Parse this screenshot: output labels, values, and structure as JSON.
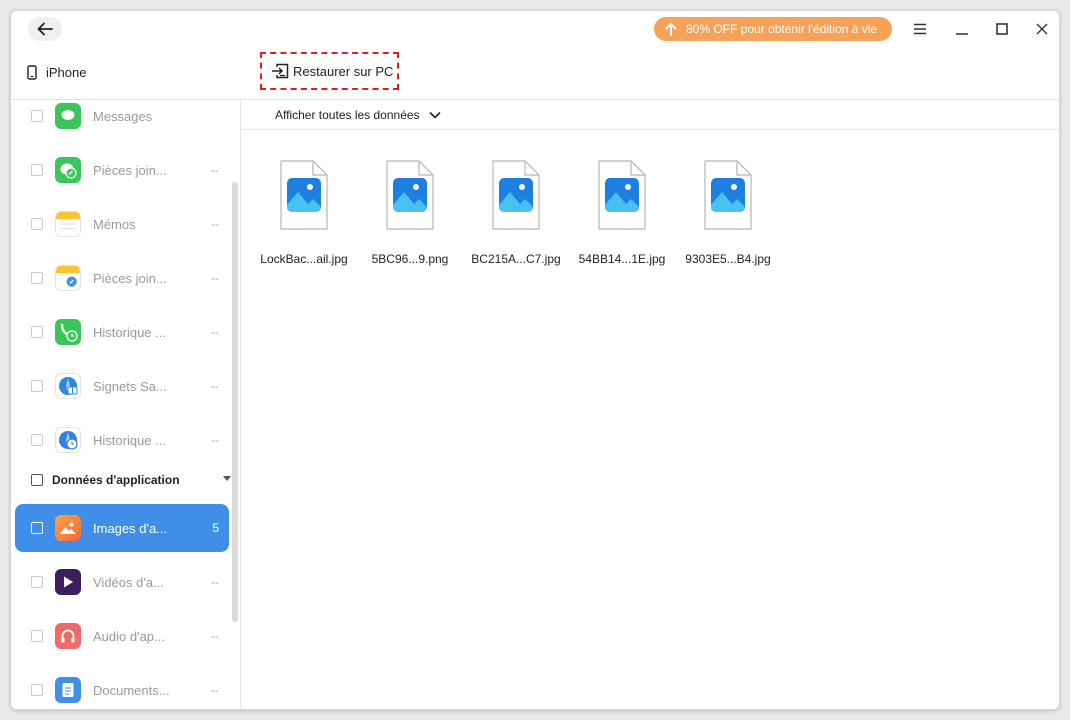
{
  "promo": {
    "label": "80% OFF pour obtenir l'édition à vie"
  },
  "device": {
    "name": "iPhone"
  },
  "toolbar": {
    "restore_label": "Restaurer sur PC"
  },
  "filter": {
    "label": "Afficher toutes les données"
  },
  "sidebar": {
    "items": [
      {
        "label": "Messages",
        "count": ""
      },
      {
        "label": "Pièces join...",
        "count": "--"
      },
      {
        "label": "Mémos",
        "count": "--"
      },
      {
        "label": "Pièces join...",
        "count": "--"
      },
      {
        "label": "Historique ...",
        "count": "--"
      },
      {
        "label": "Signets Sa...",
        "count": "--"
      },
      {
        "label": "Historique ...",
        "count": "--"
      }
    ],
    "section": {
      "label": "Données d'application"
    },
    "app_items": [
      {
        "label": "Images d'a...",
        "count": "5"
      },
      {
        "label": "Vidéos d'a...",
        "count": "--"
      },
      {
        "label": "Audio d'ap...",
        "count": "--"
      },
      {
        "label": "Documents...",
        "count": "--"
      }
    ]
  },
  "files": [
    {
      "name": "LockBac...ail.jpg"
    },
    {
      "name": "5BC96...9.png"
    },
    {
      "name": "BC215A...C7.jpg"
    },
    {
      "name": "54BB14...1E.jpg"
    },
    {
      "name": "9303E5...B4.jpg"
    }
  ],
  "colors": {
    "accent": "#3f8ee8",
    "promo": "#f5a25a",
    "highlight_border": "#e01e1e"
  }
}
